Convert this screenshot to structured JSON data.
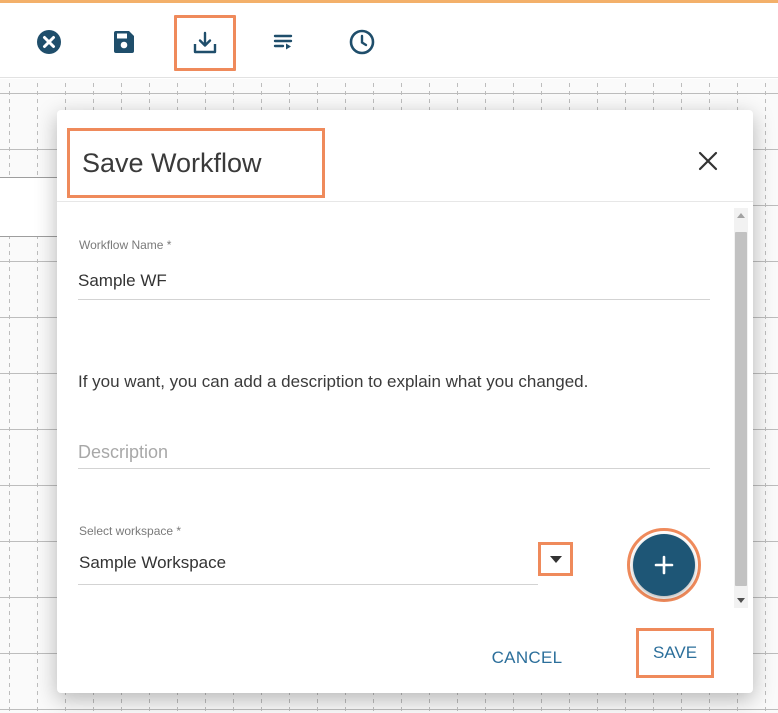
{
  "toolbar": {
    "items": [
      {
        "icon": "close-circle-icon",
        "highlighted": false
      },
      {
        "icon": "save-floppy-icon",
        "highlighted": false
      },
      {
        "icon": "download-tray-icon",
        "highlighted": true
      },
      {
        "icon": "list-arrow-icon",
        "highlighted": false
      },
      {
        "icon": "clock-history-icon",
        "highlighted": false
      }
    ]
  },
  "dialog": {
    "title": "Save Workflow",
    "workflow_name": {
      "label": "Workflow Name *",
      "value": "Sample WF"
    },
    "helper_text": "If you want, you can add a description to explain what you changed.",
    "description": {
      "placeholder": "Description",
      "value": ""
    },
    "workspace": {
      "label": "Select workspace *",
      "value": "Sample Workspace"
    },
    "add_button_icon": "plus-icon",
    "cancel_label": "CANCEL",
    "save_label": "SAVE"
  },
  "colors": {
    "highlight": "#ef8a5b",
    "primary": "#1e5676",
    "link": "#2c6f9b",
    "icon_dark": "#1f4e6b"
  }
}
